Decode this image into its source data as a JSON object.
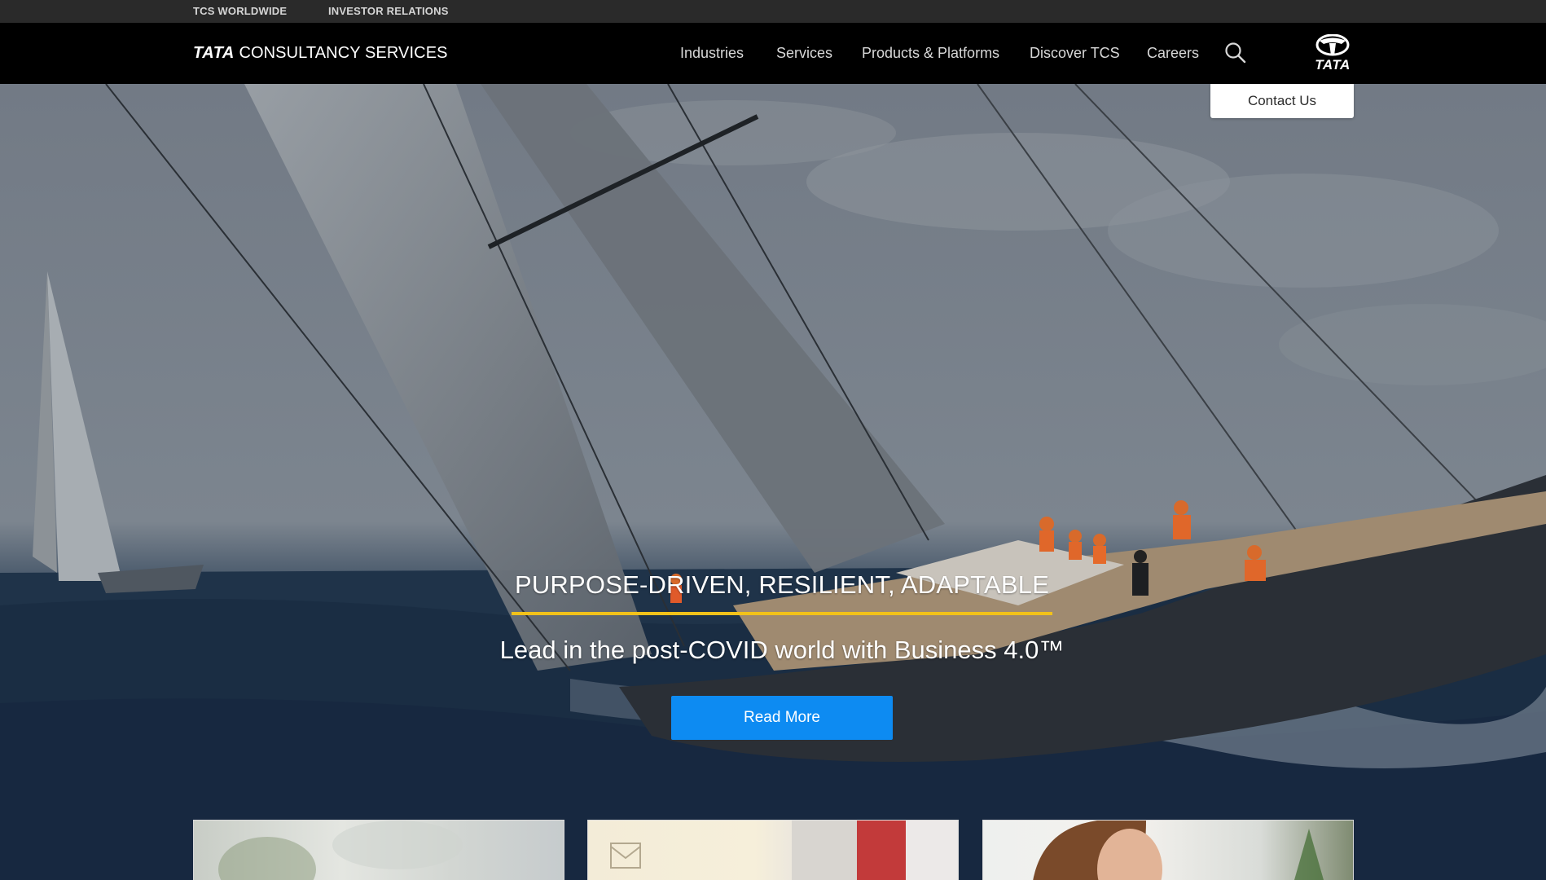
{
  "utility_bar": {
    "links": [
      "TCS WORLDWIDE",
      "INVESTOR RELATIONS"
    ]
  },
  "header": {
    "brand": {
      "bold": "TATA",
      "rest": "CONSULTANCY SERVICES"
    },
    "nav": [
      "Industries",
      "Services",
      "Products & Platforms",
      "Discover TCS",
      "Careers"
    ],
    "search_icon": "search-icon",
    "logo_text": "TATA",
    "contact_label": "Contact Us"
  },
  "hero": {
    "eyebrow": "PURPOSE-DRIVEN, RESILIENT, ADAPTABLE",
    "subtitle": "Lead in the post-COVID world with Business 4.0™",
    "cta_label": "Read More",
    "accent_color": "#f2c21a",
    "cta_color": "#0d8bf2"
  }
}
